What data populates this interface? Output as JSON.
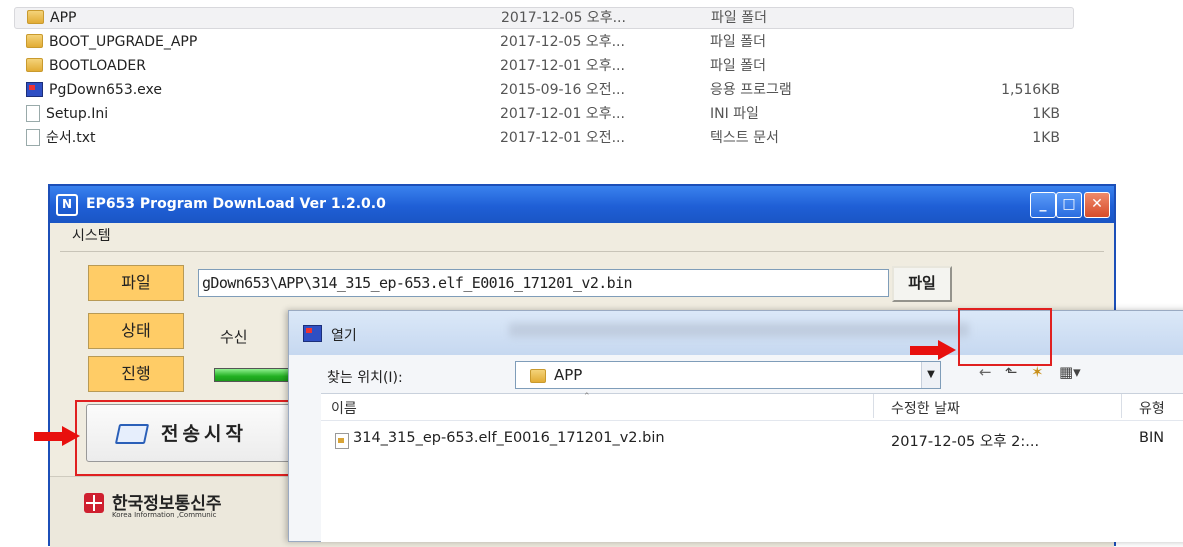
{
  "explorer": {
    "files": [
      {
        "name": "APP",
        "date": "2017-12-05 오후...",
        "type": "파일 폴더",
        "size": "",
        "icon": "folder-icon",
        "selected": true
      },
      {
        "name": "BOOT_UPGRADE_APP",
        "date": "2017-12-05 오후...",
        "type": "파일 폴더",
        "size": "",
        "icon": "folder-icon"
      },
      {
        "name": "BOOTLOADER",
        "date": "2017-12-01 오후...",
        "type": "파일 폴더",
        "size": "",
        "icon": "folder-icon"
      },
      {
        "name": "PgDown653.exe",
        "date": "2015-09-16 오전...",
        "type": "응용 프로그램",
        "size": "1,516KB",
        "icon": "exe-icon"
      },
      {
        "name": "Setup.Ini",
        "date": "2017-12-01 오후...",
        "type": "INI 파일",
        "size": "1KB",
        "icon": "document-icon"
      },
      {
        "name": "순서.txt",
        "date": "2017-12-01 오전...",
        "type": "텍스트 문서",
        "size": "1KB",
        "icon": "document-icon"
      }
    ]
  },
  "app_window": {
    "title": "EP653 Program DownLoad Ver 1.2.0.0",
    "title_icon": "N",
    "controls": {
      "minimize": "_",
      "maximize": "□",
      "close": "✕"
    },
    "menu": {
      "system": "시스템"
    },
    "labels": {
      "file": "파일",
      "status": "상태",
      "progress": "진행"
    },
    "file_path": "gDown653\\APP\\314_315_ep-653.elf_E0016_171201_v2.bin",
    "file_button": "파일",
    "status_text": "수신",
    "progress_fraction": 1.0,
    "start_button": "전송시작",
    "company_ko": "한국정보통신주",
    "company_en": "Korea Information ,Communic"
  },
  "open_dialog": {
    "title": "열기",
    "look_in_label": "찾는 위치(I):",
    "look_in_value": "APP",
    "dropdown_glyph": "▼",
    "toolbar": {
      "back": "←",
      "up": "⬑",
      "new_folder": "✶",
      "view": "▦▾"
    },
    "columns": {
      "name": "이름",
      "date_modified": "수정한 날짜",
      "type": "유형"
    },
    "sort_caret": "⌃",
    "files": [
      {
        "name": "314_315_ep-653.elf_E0016_171201_v2.bin",
        "date": "2017-12-05 오후 2:...",
        "type": "BIN"
      }
    ]
  },
  "colors": {
    "accent_red": "#e8100e",
    "title_blue": "#1f5fd6",
    "label_orange": "#ffcc66"
  }
}
